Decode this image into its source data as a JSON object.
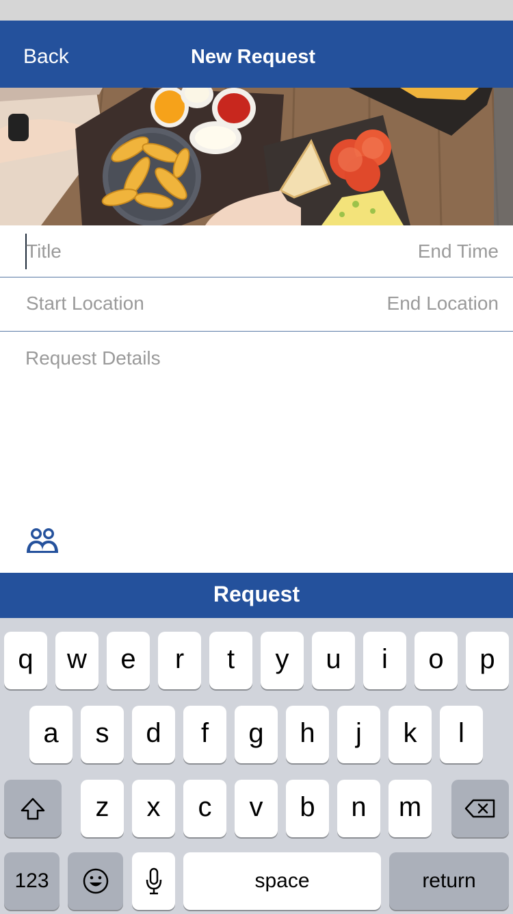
{
  "nav": {
    "back_label": "Back",
    "title": "New Request"
  },
  "form": {
    "title_placeholder": "Title",
    "end_time_placeholder": "End Time",
    "start_location_placeholder": "Start Location",
    "end_location_placeholder": "End Location",
    "details_placeholder": "Request Details"
  },
  "actions": {
    "request_label": "Request"
  },
  "keyboard": {
    "row1": [
      "q",
      "w",
      "e",
      "r",
      "t",
      "y",
      "u",
      "i",
      "o",
      "p"
    ],
    "row2": [
      "a",
      "s",
      "d",
      "f",
      "g",
      "h",
      "j",
      "k",
      "l"
    ],
    "row3": [
      "z",
      "x",
      "c",
      "v",
      "b",
      "n",
      "m"
    ],
    "numbers_label": "123",
    "space_label": "space",
    "return_label": "return",
    "icons": {
      "shift": "shift-icon",
      "backspace": "backspace-icon",
      "emoji": "emoji-icon",
      "mic": "microphone-icon"
    }
  },
  "icons": {
    "group": "group-people-icon"
  },
  "colors": {
    "brand": "#24519c",
    "keyboard_bg": "#d1d4db",
    "placeholder": "#9a9a9a"
  }
}
